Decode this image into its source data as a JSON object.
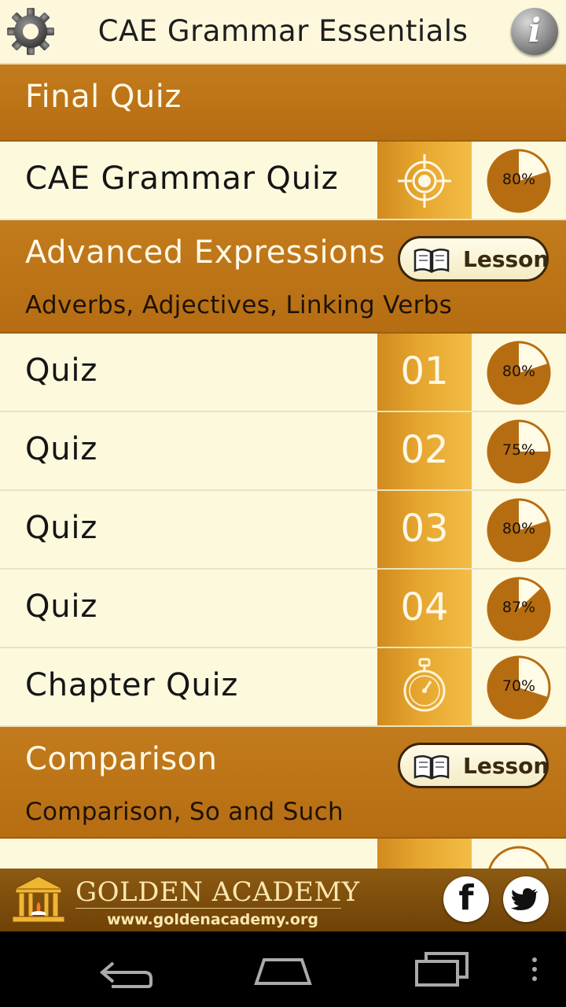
{
  "header": {
    "title": "CAE Grammar Essentials"
  },
  "final_quiz": {
    "title": "Final Quiz",
    "rows": [
      {
        "label": "CAE Grammar Quiz",
        "icon": "target-icon",
        "progress": "80%",
        "progress_value": 0.8
      }
    ]
  },
  "sections": [
    {
      "title": "Advanced Expressions",
      "subtitle": "Adverbs, Adjectives, Linking Verbs",
      "lesson_label": "Lesson",
      "rows": [
        {
          "label": "Quiz",
          "number": "01",
          "progress": "80%",
          "progress_value": 0.8
        },
        {
          "label": "Quiz",
          "number": "02",
          "progress": "75%",
          "progress_value": 0.75
        },
        {
          "label": "Quiz",
          "number": "03",
          "progress": "80%",
          "progress_value": 0.8
        },
        {
          "label": "Quiz",
          "number": "04",
          "progress": "87%",
          "progress_value": 0.87
        },
        {
          "label": "Chapter Quiz",
          "icon": "stopwatch-icon",
          "progress": "70%",
          "progress_value": 0.7
        }
      ]
    },
    {
      "title": "Comparison",
      "subtitle": "Comparison, So and Such",
      "lesson_label": "Lesson"
    }
  ],
  "footer": {
    "brand": "GOLDEN ACADEMY",
    "url": "www.goldenacademy.org",
    "social": [
      {
        "icon": "facebook-icon",
        "glyph": "f"
      },
      {
        "icon": "twitter-icon"
      }
    ]
  },
  "colors": {
    "section_bg": "#b66d12",
    "row_bg": "#fdf9dd",
    "accent_gold": "#e6a62f",
    "pie_fill": "#b66d12",
    "footer_bg": "#7a4a08"
  }
}
